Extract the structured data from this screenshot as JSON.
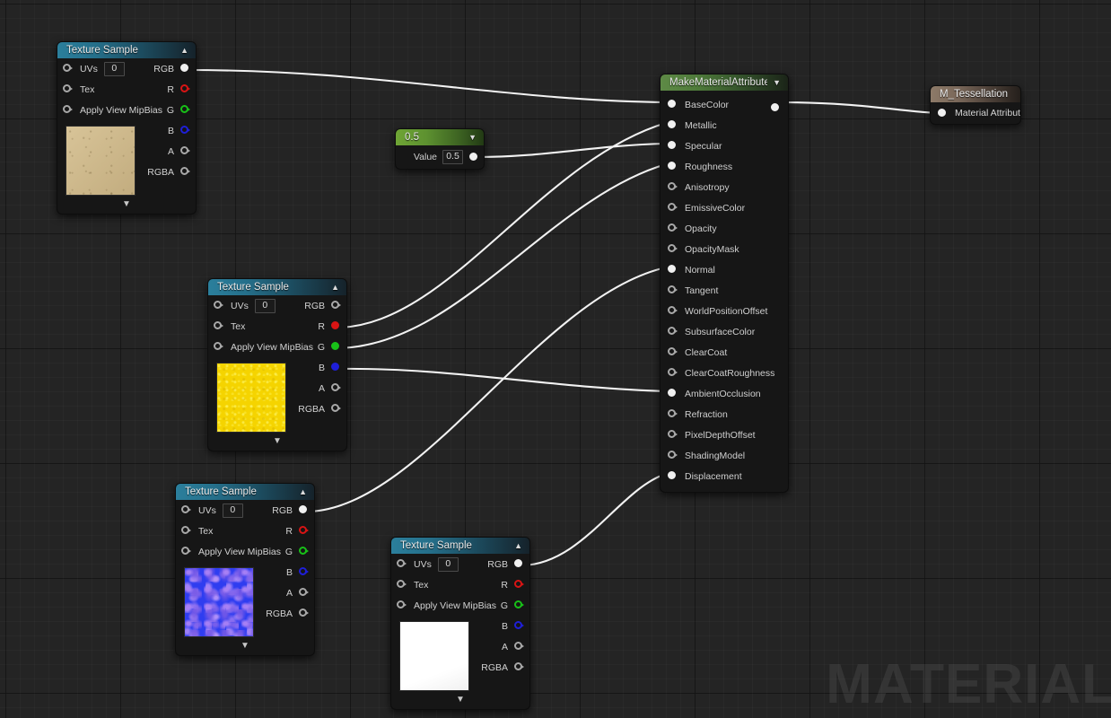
{
  "canvas": {
    "watermark": "MATERIAL",
    "background_color": "#242424"
  },
  "nodes": {
    "texture_sample_1": {
      "title": "Texture Sample",
      "collapse_icon": "chevron-up-icon",
      "expand_icon": "chevron-down-icon",
      "inputs": [
        {
          "label": "UVs",
          "value": "0",
          "connected": false
        },
        {
          "label": "Tex",
          "connected": false
        },
        {
          "label": "Apply View MipBias",
          "connected": false
        }
      ],
      "outputs": [
        {
          "label": "RGB",
          "color": "#f0f0f0",
          "connected": true
        },
        {
          "label": "R",
          "color": "#d81414",
          "connected": false
        },
        {
          "label": "G",
          "color": "#18c018",
          "connected": false
        },
        {
          "label": "B",
          "color": "#1f1fd8",
          "connected": false
        },
        {
          "label": "A",
          "color": "#a8a8a8",
          "connected": false
        },
        {
          "label": "RGBA",
          "color": "#a8a8a8",
          "connected": false
        }
      ],
      "preview": "sand-texture"
    },
    "texture_sample_2": {
      "title": "Texture Sample",
      "collapse_icon": "chevron-up-icon",
      "expand_icon": "chevron-down-icon",
      "inputs": [
        {
          "label": "UVs",
          "value": "0",
          "connected": false
        },
        {
          "label": "Tex",
          "connected": false
        },
        {
          "label": "Apply View MipBias",
          "connected": false
        }
      ],
      "outputs": [
        {
          "label": "RGB",
          "color": "#a8a8a8",
          "connected": false
        },
        {
          "label": "R",
          "color": "#d81414",
          "connected": true
        },
        {
          "label": "G",
          "color": "#18c018",
          "connected": true
        },
        {
          "label": "B",
          "color": "#1f1fd8",
          "connected": true
        },
        {
          "label": "A",
          "color": "#a8a8a8",
          "connected": false
        },
        {
          "label": "RGBA",
          "color": "#a8a8a8",
          "connected": false
        }
      ],
      "preview": "yellow-texture"
    },
    "texture_sample_3": {
      "title": "Texture Sample",
      "collapse_icon": "chevron-up-icon",
      "expand_icon": "chevron-down-icon",
      "inputs": [
        {
          "label": "UVs",
          "value": "0",
          "connected": false
        },
        {
          "label": "Tex",
          "connected": false
        },
        {
          "label": "Apply View MipBias",
          "connected": false
        }
      ],
      "outputs": [
        {
          "label": "RGB",
          "color": "#f0f0f0",
          "connected": true
        },
        {
          "label": "R",
          "color": "#d81414",
          "connected": false
        },
        {
          "label": "G",
          "color": "#18c018",
          "connected": false
        },
        {
          "label": "B",
          "color": "#1f1fd8",
          "connected": false
        },
        {
          "label": "A",
          "color": "#a8a8a8",
          "connected": false
        },
        {
          "label": "RGBA",
          "color": "#a8a8a8",
          "connected": false
        }
      ],
      "preview": "normal-map-texture"
    },
    "texture_sample_4": {
      "title": "Texture Sample",
      "collapse_icon": "chevron-up-icon",
      "expand_icon": "chevron-down-icon",
      "inputs": [
        {
          "label": "UVs",
          "value": "0",
          "connected": false
        },
        {
          "label": "Tex",
          "connected": false
        },
        {
          "label": "Apply View MipBias",
          "connected": false
        }
      ],
      "outputs": [
        {
          "label": "RGB",
          "color": "#f0f0f0",
          "connected": true
        },
        {
          "label": "R",
          "color": "#d81414",
          "connected": false
        },
        {
          "label": "G",
          "color": "#18c018",
          "connected": false
        },
        {
          "label": "B",
          "color": "#1f1fd8",
          "connected": false
        },
        {
          "label": "A",
          "color": "#a8a8a8",
          "connected": false
        },
        {
          "label": "RGBA",
          "color": "#a8a8a8",
          "connected": false
        }
      ],
      "preview": "white-texture"
    },
    "constant": {
      "title": "0.5",
      "expand_icon": "chevron-down-icon",
      "value_label": "Value",
      "value": "0.5",
      "output_connected": true
    },
    "make_material_attributes": {
      "title": "MakeMaterialAttributes",
      "expand_icon": "chevron-down-icon",
      "output_connected": true,
      "inputs": [
        {
          "label": "BaseColor",
          "connected": true
        },
        {
          "label": "Metallic",
          "connected": true
        },
        {
          "label": "Specular",
          "connected": true
        },
        {
          "label": "Roughness",
          "connected": true
        },
        {
          "label": "Anisotropy",
          "connected": false
        },
        {
          "label": "EmissiveColor",
          "connected": false
        },
        {
          "label": "Opacity",
          "connected": false
        },
        {
          "label": "OpacityMask",
          "connected": false
        },
        {
          "label": "Normal",
          "connected": true
        },
        {
          "label": "Tangent",
          "connected": false
        },
        {
          "label": "WorldPositionOffset",
          "connected": false
        },
        {
          "label": "SubsurfaceColor",
          "connected": false
        },
        {
          "label": "ClearCoat",
          "connected": false
        },
        {
          "label": "ClearCoatRoughness",
          "connected": false
        },
        {
          "label": "AmbientOcclusion",
          "connected": true
        },
        {
          "label": "Refraction",
          "connected": false
        },
        {
          "label": "PixelDepthOffset",
          "connected": false
        },
        {
          "label": "ShadingModel",
          "connected": false
        },
        {
          "label": "Displacement",
          "connected": true
        }
      ]
    },
    "result": {
      "title": "M_Tessellation",
      "input_label": "Material Attributes",
      "input_connected": true
    }
  }
}
